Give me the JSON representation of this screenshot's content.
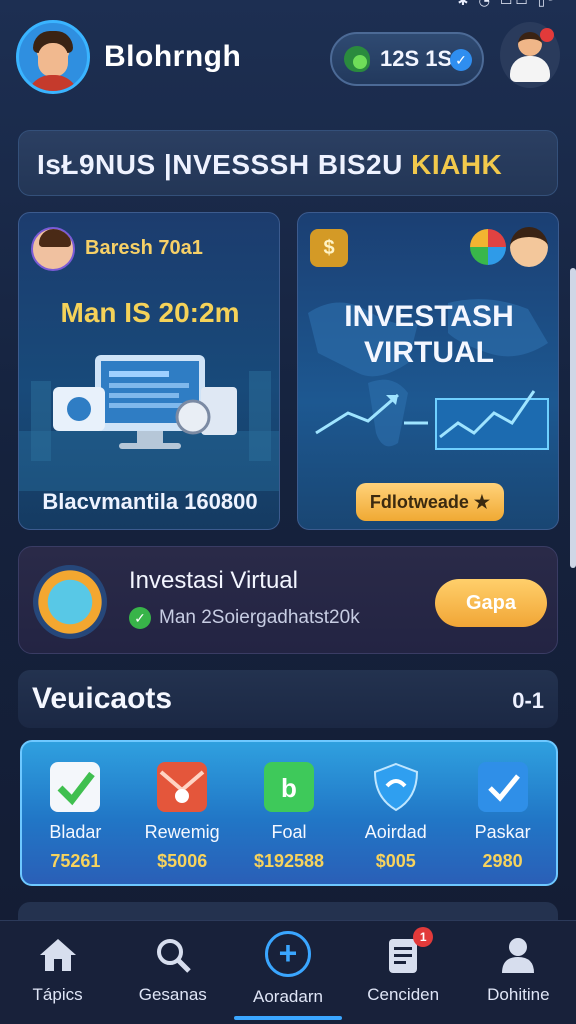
{
  "status_bar": {
    "icons": "✱ ◔ ▭▭ ▯ᵃ"
  },
  "header": {
    "username": "Blohrngh",
    "balance": "12S 1S"
  },
  "banner": {
    "title_main": "IsŁ9NUS |NVESSSH BIS2U ",
    "title_accent": "KIAHK"
  },
  "card_left": {
    "name": "Baresh 70a1",
    "amount": "Man IS 20:2m",
    "footer": "Blacvmantila 160800"
  },
  "card_right": {
    "title_line1": "INVESTASH",
    "title_line2": "VIRTUAL",
    "button": "Fdlotweade ★",
    "coin_symbol": "$"
  },
  "info": {
    "title": "Investasi Virtual",
    "subtitle": "Man 2Soiergadhatst20k",
    "button": "Gapa"
  },
  "section": {
    "title": "Veuicaots",
    "count": "0-1"
  },
  "quick_actions": [
    {
      "icon": "check-icon",
      "label": "Bladar",
      "value": "75261",
      "color": "#3fbf4f"
    },
    {
      "icon": "envelope-icon",
      "label": "Rewemig",
      "value": "$5006",
      "color": "#e4563b"
    },
    {
      "icon": "shopping-bag-icon",
      "label": "Foal",
      "value": "$192588",
      "color": "#3ec95a"
    },
    {
      "icon": "shield-icon",
      "label": "Aoirdad",
      "value": "$005",
      "color": "#2f9ff0"
    },
    {
      "icon": "checklist-icon",
      "label": "Paskar",
      "value": "2980",
      "color": "#2f8fe8"
    }
  ],
  "nav": [
    {
      "icon": "home-icon",
      "label": "Tápics"
    },
    {
      "icon": "search-icon",
      "label": "Gesanas"
    },
    {
      "icon": "plus-icon",
      "label": "Aoradarn"
    },
    {
      "icon": "document-icon",
      "label": "Cenciden",
      "badge": "1"
    },
    {
      "icon": "person-icon",
      "label": "Dohitine"
    }
  ]
}
